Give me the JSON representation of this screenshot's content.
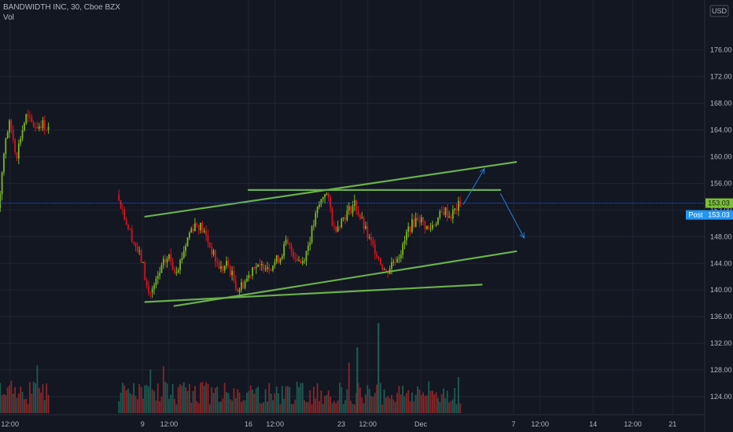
{
  "header": {
    "symbol_line": "BANDWIDTH INC, 30, Cboe BZX",
    "volume_label": "Vol"
  },
  "chart_data": {
    "type": "candlestick",
    "title": "BANDWIDTH INC, 30, Cboe BZX",
    "currency": "USD",
    "ylim": [
      122,
      177
    ],
    "price_ticks": [
      124,
      128,
      132,
      136,
      140,
      144,
      148,
      152,
      156,
      160,
      164,
      168,
      172,
      176
    ],
    "price_tick_labels": [
      "124.00",
      "128.00",
      "132.00",
      "136.00",
      "140.00",
      "144.00",
      "148.00",
      "152.00",
      "156.00",
      "160.00",
      "164.00",
      "168.00",
      "172.00",
      "176.00"
    ],
    "time_labels": [
      {
        "label": "12:00",
        "day": 0.5
      },
      {
        "label": "9",
        "day": 3.0
      },
      {
        "label": "12:00",
        "day": 3.5
      },
      {
        "label": "16",
        "day": 5.0
      },
      {
        "label": "12:00",
        "day": 5.5
      },
      {
        "label": "23",
        "day": 6.75
      },
      {
        "label": "12:00",
        "day": 7.25
      },
      {
        "label": "Dec",
        "day": 8.25
      },
      {
        "label": "7",
        "day": 10.0
      },
      {
        "label": "12:00",
        "day": 10.5
      },
      {
        "label": "14",
        "day": 11.5
      },
      {
        "label": "12:00",
        "day": 12.25
      },
      {
        "label": "21",
        "day": 13.0
      }
    ],
    "price_path": [
      [
        0.0,
        155
      ],
      [
        0.12,
        151
      ],
      [
        0.2,
        150
      ],
      [
        0.3,
        153
      ],
      [
        0.35,
        158
      ],
      [
        0.42,
        163
      ],
      [
        0.5,
        165
      ],
      [
        0.58,
        162
      ],
      [
        0.62,
        160
      ],
      [
        0.7,
        163
      ],
      [
        0.8,
        166
      ],
      [
        0.9,
        165
      ],
      [
        1.0,
        164.5
      ],
      [
        1.1,
        165
      ],
      [
        1.25,
        164
      ],
      [
        2.55,
        154
      ],
      [
        2.7,
        150
      ],
      [
        2.85,
        147
      ],
      [
        3.0,
        144
      ],
      [
        3.1,
        139.5
      ],
      [
        3.2,
        140
      ],
      [
        3.3,
        142
      ],
      [
        3.4,
        144
      ],
      [
        3.5,
        145
      ],
      [
        3.6,
        143
      ],
      [
        3.7,
        144
      ],
      [
        3.9,
        149
      ],
      [
        4.0,
        150
      ],
      [
        4.1,
        149.5
      ],
      [
        4.2,
        148
      ],
      [
        4.3,
        146
      ],
      [
        4.4,
        144
      ],
      [
        4.5,
        143
      ],
      [
        4.6,
        144
      ],
      [
        4.7,
        142
      ],
      [
        4.8,
        140
      ],
      [
        4.9,
        141
      ],
      [
        5.0,
        142
      ],
      [
        5.1,
        144
      ],
      [
        5.2,
        143
      ],
      [
        5.3,
        144
      ],
      [
        5.4,
        143.5
      ],
      [
        5.6,
        145
      ],
      [
        5.7,
        147
      ],
      [
        5.8,
        146
      ],
      [
        5.9,
        145
      ],
      [
        6.0,
        144
      ],
      [
        6.1,
        146
      ],
      [
        6.2,
        149
      ],
      [
        6.3,
        152
      ],
      [
        6.4,
        154
      ],
      [
        6.45,
        155
      ],
      [
        6.55,
        152
      ],
      [
        6.6,
        149
      ],
      [
        6.7,
        150
      ],
      [
        6.8,
        151
      ],
      [
        6.9,
        152
      ],
      [
        7.0,
        153
      ],
      [
        7.3,
        147
      ],
      [
        7.4,
        146
      ],
      [
        7.5,
        144
      ],
      [
        7.6,
        142.5
      ],
      [
        7.7,
        144
      ],
      [
        7.8,
        145
      ],
      [
        7.9,
        146
      ],
      [
        8.0,
        149
      ],
      [
        8.1,
        150
      ],
      [
        8.2,
        151
      ],
      [
        8.3,
        150
      ],
      [
        8.4,
        149
      ],
      [
        8.5,
        150
      ],
      [
        8.6,
        151
      ],
      [
        8.7,
        152
      ],
      [
        8.8,
        151
      ],
      [
        8.9,
        152
      ],
      [
        9.0,
        153.03
      ]
    ],
    "volume_bars": 260,
    "volume_spikes": [
      {
        "day": 7.05,
        "volume": 0.62
      },
      {
        "day": 7.45,
        "volume": 0.85
      }
    ],
    "last_price": "153.03",
    "post_label": "Post",
    "post_price": "153.03",
    "trendlines": [
      {
        "color": "#6ab04c",
        "from": [
          3.05,
          151
        ],
        "to": [
          10.05,
          159.2
        ]
      },
      {
        "color": "#6ab04c",
        "from": [
          5.0,
          155
        ],
        "to": [
          9.75,
          155
        ]
      },
      {
        "color": "#6ab04c",
        "from": [
          3.05,
          138.2
        ],
        "to": [
          9.4,
          140.8
        ]
      },
      {
        "color": "#6ab04c",
        "from": [
          3.6,
          137.6
        ],
        "to": [
          10.05,
          145.8
        ]
      }
    ],
    "projection_arrows": [
      {
        "color": "#2a7fd4",
        "from": [
          9.05,
          152.8
        ],
        "to": [
          9.45,
          158.2
        ]
      },
      {
        "color": "#2a7fd4",
        "from": [
          9.75,
          154.5
        ],
        "to": [
          10.2,
          147.8
        ]
      }
    ],
    "colors": {
      "background": "#131722",
      "grid": "#1f2432",
      "up": "#7ab520",
      "down": "#d4141e",
      "volume_up": "#1e5a52",
      "volume_down": "#8a2628",
      "price_line": "#2962ff",
      "last_price_label": "#7ac231",
      "post_label": "#2196f3",
      "text": "#b2b5be"
    }
  }
}
